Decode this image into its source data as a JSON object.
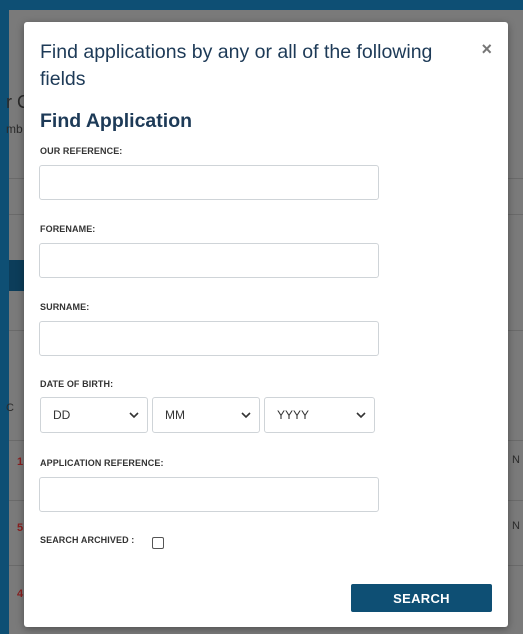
{
  "modal": {
    "title": "Find applications by any or all of the following fields",
    "close_glyph": "×",
    "section_title": "Find Application",
    "fields": {
      "our_reference": {
        "label": "OUR REFERENCE:",
        "value": ""
      },
      "forename": {
        "label": "FORENAME:",
        "value": ""
      },
      "surname": {
        "label": "SURNAME:",
        "value": ""
      },
      "date_of_birth": {
        "label": "DATE OF BIRTH:",
        "day": "DD",
        "month": "MM",
        "year": "YYYY"
      },
      "application_reference": {
        "label": "APPLICATION REFERENCE:",
        "value": ""
      },
      "search_archived": {
        "label": "SEARCH ARCHIVED :",
        "checked": false
      }
    },
    "search_label": "SEARCH"
  },
  "background": {
    "fragments": [
      "r C",
      "mb",
      "C",
      "1",
      "5",
      "4",
      "N",
      "N"
    ]
  },
  "colors": {
    "brand": "#0e4f74",
    "title": "#1d3a57"
  },
  "icons": {
    "close": "close-icon",
    "dropdown": "chevron-down-icon"
  }
}
